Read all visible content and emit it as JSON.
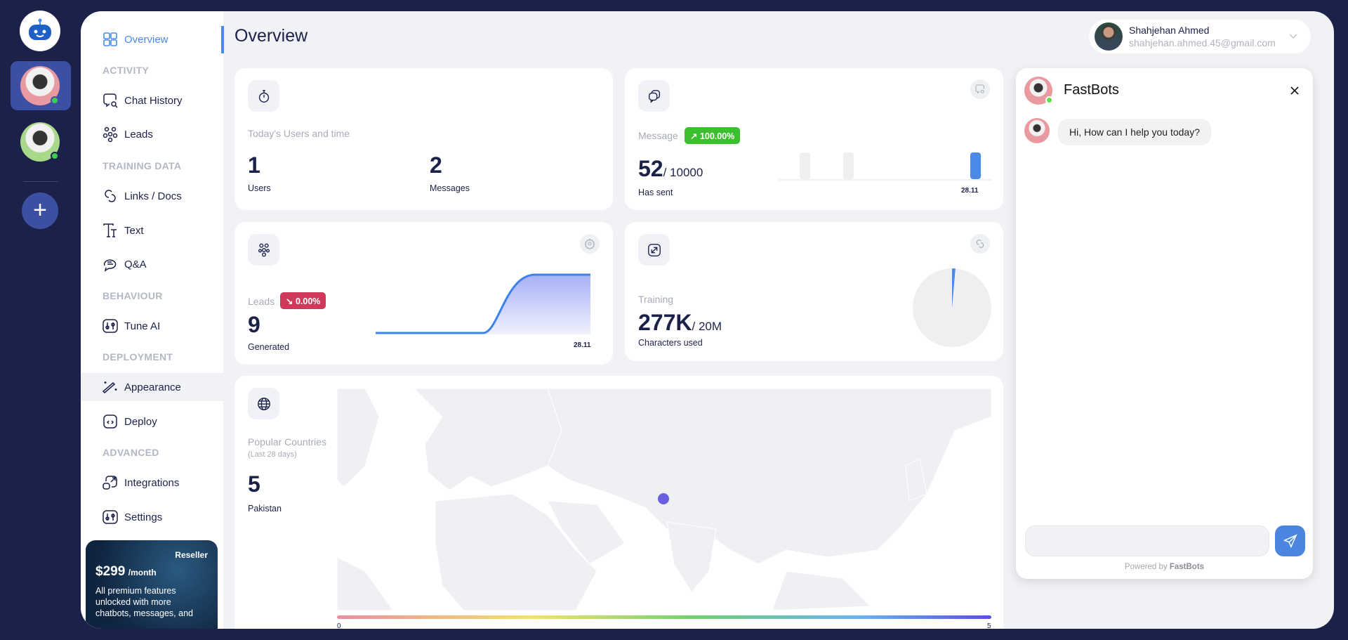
{
  "rail": {
    "bots": [
      {
        "name": "bot-1",
        "selected": true,
        "color": "#e89aa0"
      },
      {
        "name": "bot-2",
        "selected": false,
        "color": "#a8d88a"
      }
    ],
    "add_label": "+"
  },
  "sidebar": {
    "overview": "Overview",
    "sections": {
      "activity": "ACTIVITY",
      "training": "TRAINING DATA",
      "behaviour": "BEHAVIOUR",
      "deployment": "DEPLOYMENT",
      "advanced": "ADVANCED"
    },
    "items": {
      "chat_history": "Chat History",
      "leads": "Leads",
      "links_docs": "Links / Docs",
      "text": "Text",
      "qa": "Q&A",
      "tune_ai": "Tune AI",
      "appearance": "Appearance",
      "deploy": "Deploy",
      "integrations": "Integrations",
      "settings": "Settings"
    },
    "reseller": {
      "title": "Reseller",
      "price": "$299",
      "period": "/month",
      "desc": "All premium features unlocked with more chatbots, messages, and"
    }
  },
  "header": {
    "title": "Overview",
    "user": {
      "name": "Shahjehan Ahmed",
      "email": "shahjehan.ahmed.45@gmail.com"
    }
  },
  "cards": {
    "users": {
      "label": "Today's Users and time",
      "users_value": "1",
      "users_label": "Users",
      "messages_value": "2",
      "messages_label": "Messages"
    },
    "messages": {
      "label": "Message",
      "badge": "↗ 100.00%",
      "value": "52",
      "limit": "/ 10000",
      "sub": "Has sent",
      "tick": "28.11",
      "bars": [
        1,
        1,
        0,
        0,
        1
      ],
      "highlight_index": 4
    },
    "leads": {
      "label": "Leads",
      "badge": "↘ 0.00%",
      "value": "9",
      "sub": "Generated",
      "tick": "28.11"
    },
    "training": {
      "label": "Training",
      "value": "277K",
      "limit": "/ 20M",
      "sub": "Characters used",
      "used_fraction": 0.0139
    },
    "countries": {
      "label": "Popular Countries",
      "period": "(Last 28 days)",
      "value": "5",
      "country": "Pakistan",
      "scale_min": "0",
      "scale_max": "5"
    }
  },
  "chat": {
    "title": "FastBots",
    "message": "Hi, How can I help you today?",
    "input_placeholder": "",
    "powered_prefix": "Powered by ",
    "powered_brand": "FastBots"
  },
  "colors": {
    "navy": "#1b2149",
    "accent": "#4a8be8",
    "green": "#3bbf2f",
    "red": "#d0395a"
  }
}
